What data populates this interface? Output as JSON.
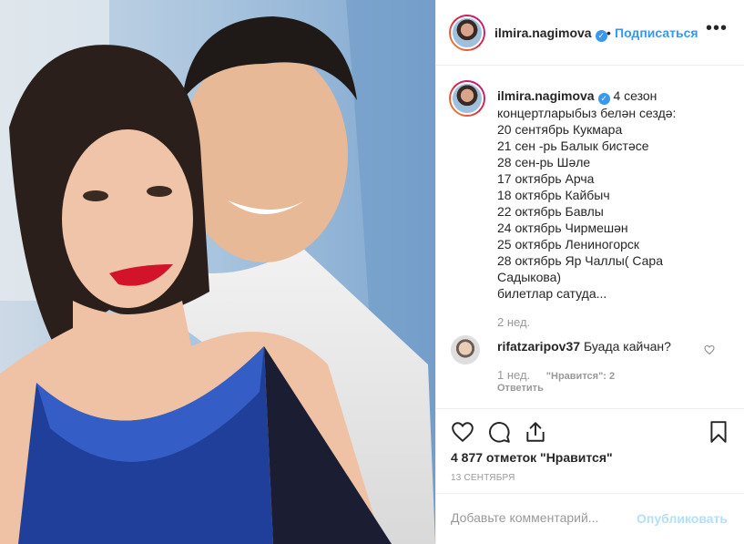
{
  "post": {
    "username": "ilmira.nagimova",
    "follow_label": "Подписаться",
    "more_label": "•••",
    "separator": "•",
    "verified_mark": "✓"
  },
  "caption": {
    "username": "ilmira.nagimova",
    "first_text": "4 сезон",
    "lines": [
      "концертларыбыз белән сездә:",
      "20 сентябрь Кукмара",
      "21 сен -рь Балык бистәсе",
      "28 сен-рь Шәле",
      "17 октябрь Арча",
      "18 октябрь Кайбыч",
      "22 октябрь Бавлы",
      "24 октябрь Чирмешән",
      "25 октябрь Лениногорск",
      "28 октябрь Яр Чаллы( Сара",
      "Садыкова)",
      "билетлар сатуда..."
    ],
    "time": "2 нед."
  },
  "comment": {
    "username": "rifatzaripov37",
    "text": "Буада кайчан?",
    "time": "1 нед.",
    "likes": "\"Нравится\": 2",
    "reply_label": "Ответить"
  },
  "stats": {
    "likes": "4 877 отметок \"Нравится\"",
    "date": "13 СЕНТЯБРЯ"
  },
  "add_comment": {
    "placeholder": "Добавьте комментарий...",
    "publish_label": "Опубликовать"
  },
  "icons": [
    "heart-icon",
    "comment-icon",
    "share-icon",
    "bookmark-icon",
    "verified-icon",
    "more-icon"
  ],
  "colors": {
    "link": "#3897f0",
    "publish_disabled": "#b2dffc",
    "muted": "#999999",
    "text": "#262626"
  }
}
